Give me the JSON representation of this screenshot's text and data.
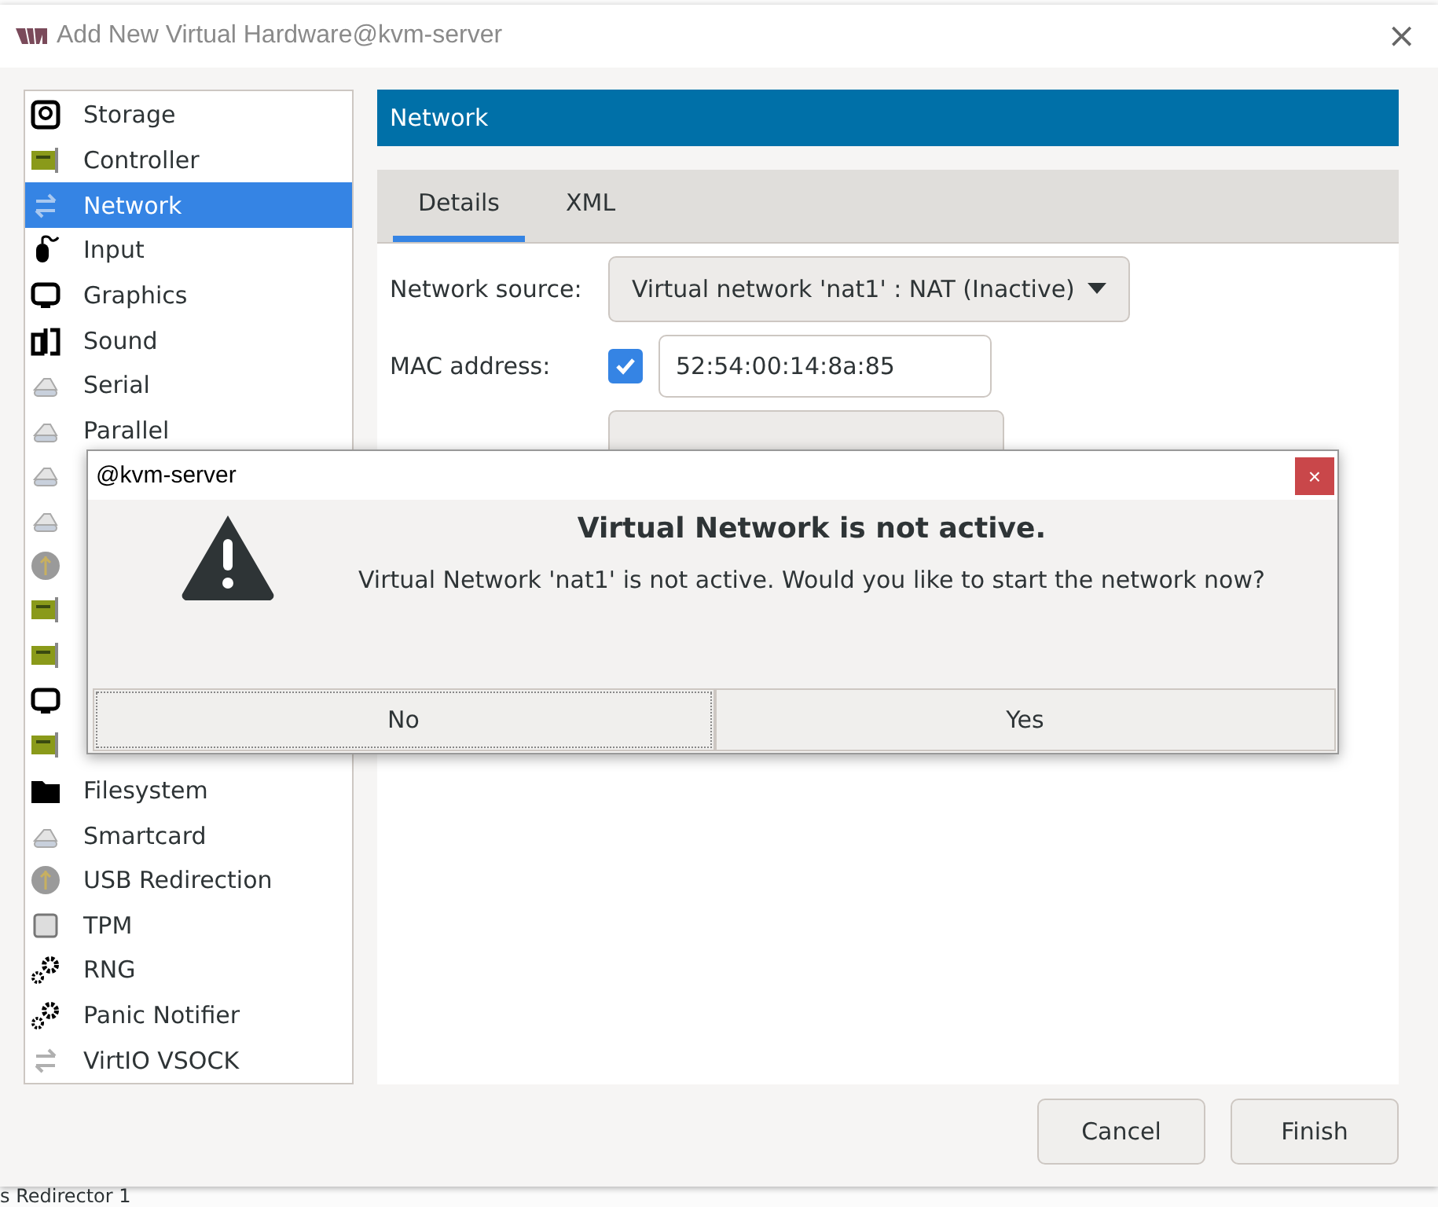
{
  "window": {
    "title": "Add New Virtual Hardware@kvm-server",
    "close": "×"
  },
  "sidebar": {
    "items": [
      {
        "label": "Storage",
        "kind": "disk",
        "selected": false
      },
      {
        "label": "Controller",
        "kind": "card",
        "selected": false
      },
      {
        "label": "Network",
        "kind": "arrows",
        "selected": true
      },
      {
        "label": "Input",
        "kind": "mouse",
        "selected": false
      },
      {
        "label": "Graphics",
        "kind": "monitor",
        "selected": false
      },
      {
        "label": "Sound",
        "kind": "sound",
        "selected": false
      },
      {
        "label": "Serial",
        "kind": "port",
        "selected": false
      },
      {
        "label": "Parallel",
        "kind": "port",
        "selected": false
      },
      {
        "kind": "port",
        "selected": false
      },
      {
        "kind": "port",
        "selected": false
      },
      {
        "kind": "usb",
        "selected": false
      },
      {
        "kind": "card",
        "selected": false
      },
      {
        "kind": "card",
        "selected": false
      },
      {
        "kind": "monitor",
        "selected": false
      },
      {
        "kind": "card",
        "selected": false
      },
      {
        "label": "Filesystem",
        "kind": "folder",
        "selected": false
      },
      {
        "label": "Smartcard",
        "kind": "port",
        "selected": false
      },
      {
        "label": "USB Redirection",
        "kind": "usb",
        "selected": false
      },
      {
        "label": "TPM",
        "kind": "chip",
        "selected": false
      },
      {
        "label": "RNG",
        "kind": "gears",
        "selected": false
      },
      {
        "label": "Panic Notifier",
        "kind": "gears",
        "selected": false
      },
      {
        "label": "VirtIO VSOCK",
        "kind": "arrows",
        "selected": false
      }
    ]
  },
  "panel": {
    "header": "Network",
    "tabs": [
      {
        "label": "Details",
        "selected": true
      },
      {
        "label": "XML",
        "selected": false
      }
    ],
    "network_source": {
      "label": "Network source:",
      "value": "Virtual network 'nat1' : NAT (Inactive)"
    },
    "mac_address": {
      "label": "MAC address:",
      "checked": true,
      "value": "52:54:00:14:8a:85"
    }
  },
  "buttons": [
    "Cancel",
    "Finish"
  ],
  "dialog": {
    "title": "@kvm-server",
    "close": "×",
    "heading": "Virtual Network is not active.",
    "message": "Virtual Network 'nat1' is not active. Would you like to start the network now?",
    "buttons": [
      {
        "label": "No",
        "focused": true
      },
      {
        "label": "Yes",
        "focused": false
      }
    ]
  },
  "background": {
    "text": "s Redirector 1"
  }
}
